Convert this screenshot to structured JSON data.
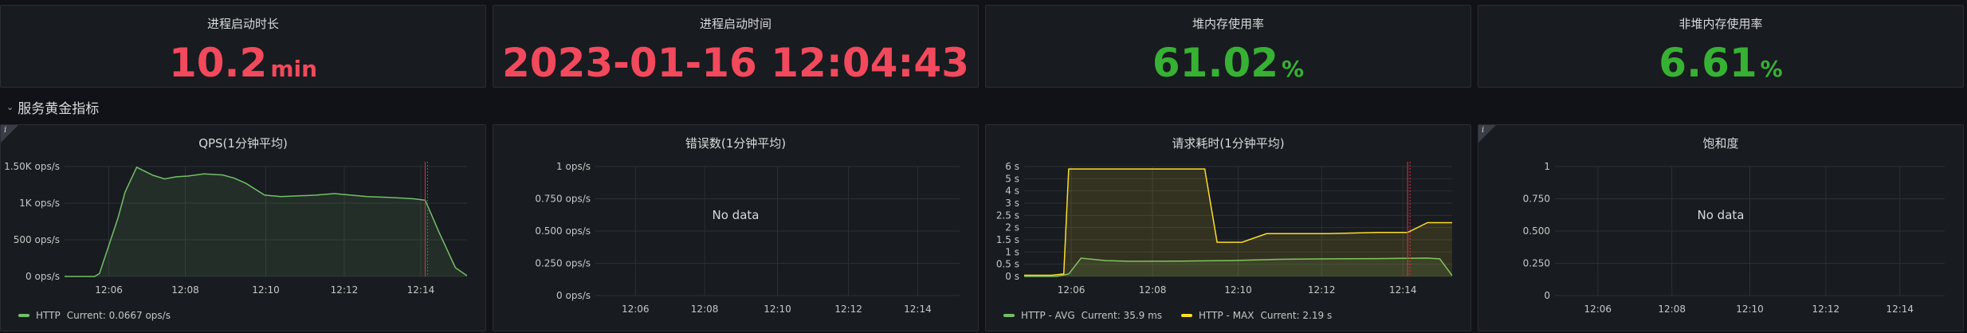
{
  "stats": [
    {
      "title": "进程启动时长",
      "value": "10.2",
      "unit": "min",
      "color": "#f2495c"
    },
    {
      "title": "进程启动时间",
      "value": "2023-01-16 12:04:43",
      "unit": "",
      "color": "#f2495c"
    },
    {
      "title": "堆内存使用率",
      "value": "61.02",
      "unit": "%",
      "color": "#37b134"
    },
    {
      "title": "非堆内存使用率",
      "value": "6.61",
      "unit": "%",
      "color": "#37b134"
    }
  ],
  "row": {
    "label": "服务黄金指标"
  },
  "panels": [
    {
      "title": "QPS(1分钟平均)"
    },
    {
      "title": "错误数(1分钟平均)",
      "no_data": "No data"
    },
    {
      "title": "请求耗时(1分钟平均)"
    },
    {
      "title": "饱和度",
      "no_data": "No data"
    }
  ],
  "legends": {
    "qps": [
      {
        "name": "HTTP",
        "current": "Current: 0.0667 ops/s",
        "color": "#73bf69"
      }
    ],
    "latency": [
      {
        "name": "HTTP - AVG",
        "current": "Current: 35.9 ms",
        "color": "#73bf69"
      },
      {
        "name": "HTTP - MAX",
        "current": "Current: 2.19 s",
        "color": "#fade2a"
      }
    ]
  },
  "chart_data": [
    {
      "type": "area",
      "title": "QPS(1分钟平均)",
      "x_ticks": [
        "12:06",
        "12:08",
        "12:10",
        "12:12",
        "12:14"
      ],
      "y_ticks": [
        "0 ops/s",
        "500 ops/s",
        "1K ops/s",
        "1.50K ops/s"
      ],
      "ylim": [
        0,
        1500
      ],
      "xlim": [
        12.077,
        12.25
      ],
      "series": [
        {
          "name": "HTTP",
          "color": "#73bf69",
          "x": [
            12.077,
            12.09,
            12.092,
            12.1,
            12.103,
            12.108,
            12.115,
            12.12,
            12.125,
            12.13,
            12.137,
            12.145,
            12.15,
            12.155,
            12.163,
            12.17,
            12.178,
            12.185,
            12.193,
            12.2,
            12.207,
            12.215,
            12.222,
            12.227,
            12.232,
            12.238,
            12.245,
            12.25
          ],
          "y": [
            0,
            0,
            40,
            800,
            1150,
            1490,
            1380,
            1330,
            1360,
            1370,
            1400,
            1385,
            1340,
            1270,
            1110,
            1090,
            1100,
            1110,
            1130,
            1110,
            1090,
            1080,
            1070,
            1060,
            1040,
            600,
            120,
            10
          ]
        }
      ],
      "marker_x": 12.232
    },
    {
      "type": "line",
      "title": "错误数(1分钟平均)",
      "x_ticks": [
        "12:06",
        "12:08",
        "12:10",
        "12:12",
        "12:14"
      ],
      "y_ticks": [
        "0 ops/s",
        "0.250 ops/s",
        "0.500 ops/s",
        "0.750 ops/s",
        "1 ops/s"
      ],
      "ylim": [
        0,
        1
      ],
      "series": []
    },
    {
      "type": "area",
      "title": "请求耗时(1分钟平均)",
      "x_ticks": [
        "12:06",
        "12:08",
        "12:10",
        "12:12",
        "12:14"
      ],
      "y_ticks": [
        "0 s",
        "0.5 s",
        "1 s",
        "1.5 s",
        "2 s",
        "2.5 s",
        "3 s",
        "4 s",
        "5 s",
        "6 s"
      ],
      "ylim": [
        0,
        6
      ],
      "xlim": [
        12.077,
        12.25
      ],
      "series": [
        {
          "name": "HTTP - AVG",
          "color": "#73bf69",
          "x": [
            12.077,
            12.09,
            12.095,
            12.1,
            12.11,
            12.12,
            12.14,
            12.16,
            12.18,
            12.2,
            12.22,
            12.23,
            12.24,
            12.245,
            12.25
          ],
          "y": [
            0,
            0,
            0.1,
            0.75,
            0.65,
            0.62,
            0.63,
            0.65,
            0.7,
            0.72,
            0.73,
            0.74,
            0.75,
            0.72,
            0.04
          ]
        },
        {
          "name": "HTTP - MAX",
          "color": "#fade2a",
          "x": [
            12.077,
            12.088,
            12.093,
            12.095,
            12.11,
            12.14,
            12.15,
            12.155,
            12.165,
            12.175,
            12.2,
            12.22,
            12.232,
            12.24,
            12.25
          ],
          "y": [
            0.05,
            0.05,
            0.1,
            5.8,
            5.8,
            5.8,
            5.8,
            1.4,
            1.4,
            1.75,
            1.75,
            1.8,
            1.8,
            2.2,
            2.2
          ]
        }
      ],
      "marker_x": 12.232
    },
    {
      "type": "line",
      "title": "饱和度",
      "x_ticks": [
        "12:06",
        "12:08",
        "12:10",
        "12:12",
        "12:14"
      ],
      "y_ticks": [
        "0",
        "0.250",
        "0.500",
        "0.750",
        "1"
      ],
      "ylim": [
        0,
        1
      ],
      "series": []
    }
  ]
}
